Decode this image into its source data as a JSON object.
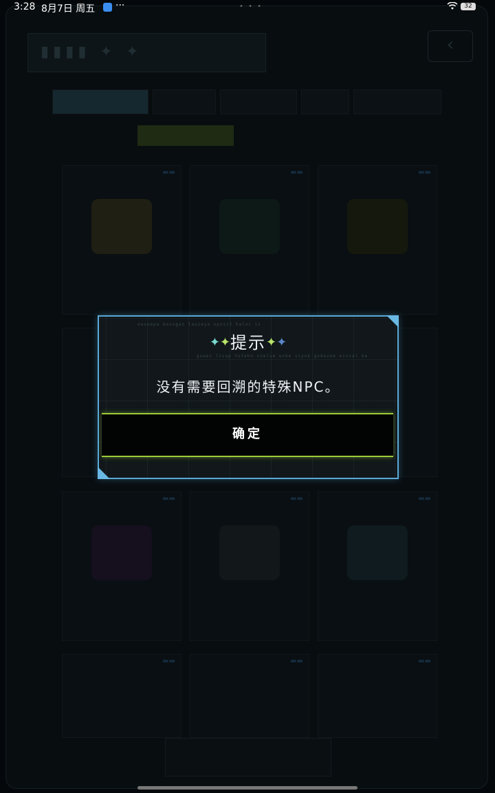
{
  "status_bar": {
    "time": "3:28",
    "date": "8月7日 周五",
    "more": "···",
    "battery": "32"
  },
  "dialog": {
    "title": "提示",
    "micro_text_top": "owowepa masogaz lauzeya oposit haloc is",
    "micro_text_bottom": "gowez livap tuteho ozelum wobe siyub godezee eiozal ke",
    "message": "没有需要回溯的特殊NPC。",
    "confirm_label": "确定",
    "border_color": "#5aa9d8",
    "button_glow_color": "#9ccc3a"
  },
  "icons": [
    "wifi-icon",
    "battery-icon",
    "app-icon",
    "sparkle-icon"
  ]
}
